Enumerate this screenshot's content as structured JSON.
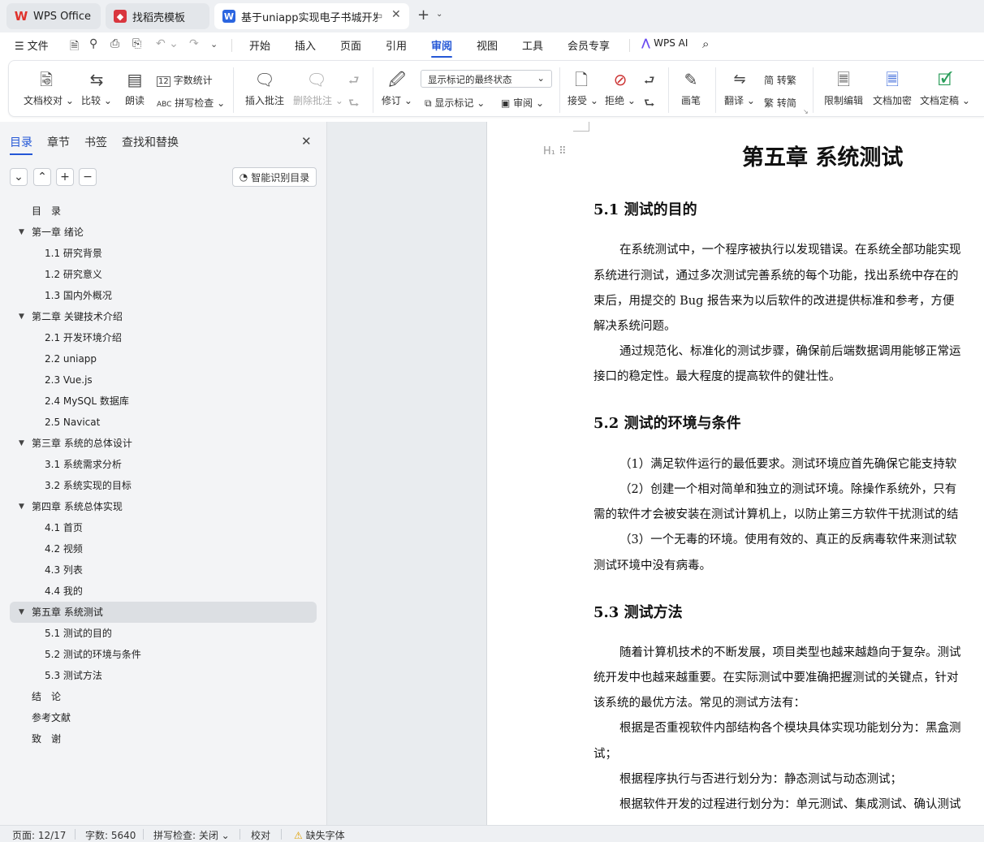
{
  "tabs": [
    {
      "label": "WPS Office"
    },
    {
      "label": "找稻壳模板"
    },
    {
      "label": "基于uniapp实现电子书城开发"
    }
  ],
  "colors": {
    "accent": "#2457d6",
    "wps_red": "#e0322c",
    "docer_red": "#d9363e",
    "writer_blue": "#2b65e0"
  },
  "menu": {
    "file_label": "文件",
    "items": [
      "开始",
      "插入",
      "页面",
      "引用",
      "审阅",
      "视图",
      "工具",
      "会员专享"
    ],
    "active": "审阅",
    "ai_label": "WPS AI"
  },
  "ribbon": {
    "proofread": "文档校对",
    "compare": "比较",
    "read_aloud": "朗读",
    "word_count": "字数统计",
    "spell_check": "拼写检查",
    "insert_comment": "插入批注",
    "delete_comment": "删除批注",
    "revise": "修订",
    "markup_state": "显示标记的最终状态",
    "show_markup": "显示标记",
    "review_pane": "审阅",
    "accept": "接受",
    "reject": "拒绝",
    "pen": "画笔",
    "translate": "翻译",
    "to_traditional": "转繁",
    "to_simplified": "转简",
    "restrict_edit": "限制编辑",
    "encrypt": "文档加密",
    "finalize": "文档定稿"
  },
  "sidebar": {
    "tabs": [
      "目录",
      "章节",
      "书签",
      "查找和替换"
    ],
    "smart_button": "智能识别目录",
    "toc": [
      {
        "label": "目　录",
        "level": 1,
        "arrow": false
      },
      {
        "label": "第一章  绪论",
        "level": 1,
        "arrow": true
      },
      {
        "label": "1.1  研究背景",
        "level": 2
      },
      {
        "label": "1.2  研究意义",
        "level": 2
      },
      {
        "label": "1.3  国内外概况",
        "level": 2
      },
      {
        "label": "第二章  关键技术介绍",
        "level": 1,
        "arrow": true
      },
      {
        "label": "2.1  开发环境介绍",
        "level": 2
      },
      {
        "label": "2.2 uniapp",
        "level": 2
      },
      {
        "label": "2.3 Vue.js",
        "level": 2
      },
      {
        "label": "2.4 MySQL 数据库",
        "level": 2
      },
      {
        "label": "2.5 Navicat",
        "level": 2
      },
      {
        "label": "第三章  系统的总体设计",
        "level": 1,
        "arrow": true
      },
      {
        "label": "3.1  系统需求分析",
        "level": 2
      },
      {
        "label": "3.2  系统实现的目标",
        "level": 2
      },
      {
        "label": "第四章  系统总体实现",
        "level": 1,
        "arrow": true
      },
      {
        "label": "4.1  首页",
        "level": 2
      },
      {
        "label": "4.2  视频",
        "level": 2
      },
      {
        "label": "4.3  列表",
        "level": 2
      },
      {
        "label": "4.4  我的",
        "level": 2
      },
      {
        "label": "第五章  系统测试",
        "level": 1,
        "arrow": true,
        "selected": true
      },
      {
        "label": "5.1  测试的目的",
        "level": 2
      },
      {
        "label": "5.2  测试的环境与条件",
        "level": 2
      },
      {
        "label": "5.3  测试方法",
        "level": 2
      },
      {
        "label": "结　论",
        "level": 1,
        "arrow": false
      },
      {
        "label": "参考文献",
        "level": 1,
        "arrow": false
      },
      {
        "label": "致　谢",
        "level": 1,
        "arrow": false
      }
    ]
  },
  "doc": {
    "chapter_title": "第五章  系统测试",
    "h_5_1": "5.1  测试的目的",
    "p1_l1": "在系统测试中，一个程序被执行以发现错误。在系统全部功能实现",
    "p1_l2": "系统进行测试，通过多次测试完善系统的每个功能，找出系统中存在的",
    "p1_l3": "束后，用提交的 Bug 报告来为以后软件的改进提供标准和参考，方便",
    "p1_l4": "解决系统问题。",
    "p2_l1": "通过规范化、标准化的测试步骤，确保前后端数据调用能够正常运",
    "p2_l2": "接口的稳定性。最大程度的提高软件的健壮性。",
    "h_5_2": "5.2  测试的环境与条件",
    "p3_l1": "（1）满足软件运行的最低要求。测试环境应首先确保它能支持软",
    "p4_l1": "（2）创建一个相对简单和独立的测试环境。除操作系统外，只有",
    "p4_l2": "需的软件才会被安装在测试计算机上，以防止第三方软件干扰测试的结",
    "p5_l1": "（3）一个无毒的环境。使用有效的、真正的反病毒软件来测试软",
    "p5_l2": "测试环境中没有病毒。",
    "h_5_3": "5.3  测试方法",
    "p6_l1": "随着计算机技术的不断发展，项目类型也越来越趋向于复杂。测试",
    "p6_l2": "统开发中也越来越重要。在实际测试中要准确把握测试的关键点，针对",
    "p6_l3": "该系统的最优方法。常见的测试方法有：",
    "p7_l1": "根据是否重视软件内部结构各个模块具体实现功能划分为：黑盒测",
    "p7_l2": "试；",
    "p8_l1": "根据程序执行与否进行划分为：静态测试与动态测试；",
    "p9_l1": "根据软件开发的过程进行划分为：单元测试、集成测试、确认测试"
  },
  "status": {
    "page": "页面: 12/17",
    "words": "字数: 5640",
    "spell": "拼写检查: 关闭",
    "proof": "校对",
    "missing_font": "缺失字体"
  }
}
